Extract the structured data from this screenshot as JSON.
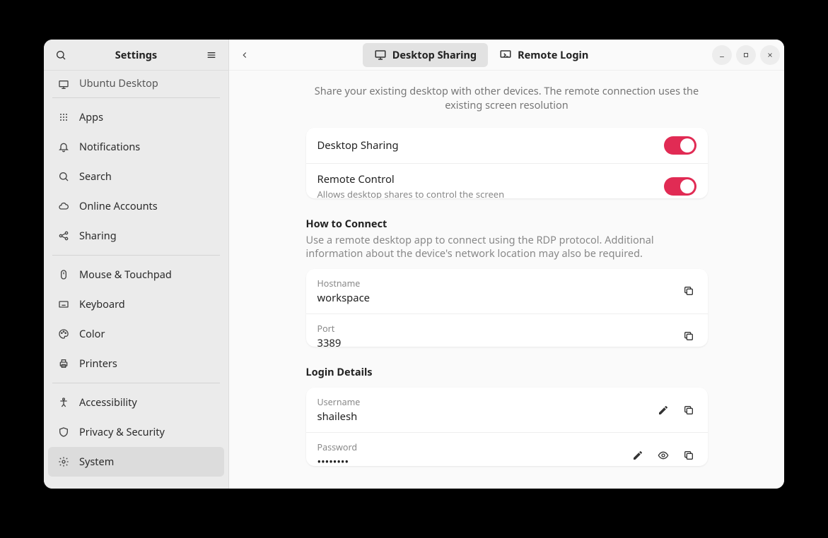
{
  "sidebar": {
    "title": "Settings",
    "partial_item_label": "Ubuntu Desktop",
    "groups": [
      [
        {
          "label": "Apps",
          "icon": "grid"
        },
        {
          "label": "Notifications",
          "icon": "bell"
        },
        {
          "label": "Search",
          "icon": "search"
        },
        {
          "label": "Online Accounts",
          "icon": "cloud"
        },
        {
          "label": "Sharing",
          "icon": "share"
        }
      ],
      [
        {
          "label": "Mouse & Touchpad",
          "icon": "mouse"
        },
        {
          "label": "Keyboard",
          "icon": "keyboard"
        },
        {
          "label": "Color",
          "icon": "palette"
        },
        {
          "label": "Printers",
          "icon": "printer"
        }
      ],
      [
        {
          "label": "Accessibility",
          "icon": "person"
        },
        {
          "label": "Privacy & Security",
          "icon": "shield"
        },
        {
          "label": "System",
          "icon": "gear",
          "active": true
        }
      ]
    ]
  },
  "header": {
    "tabs": [
      {
        "label": "Desktop Sharing",
        "active": true
      },
      {
        "label": "Remote Login",
        "active": false
      }
    ]
  },
  "intro": "Share your existing desktop with other devices. The remote connection uses the existing screen resolution",
  "toggles": {
    "desktop_sharing": {
      "title": "Desktop Sharing",
      "on": true
    },
    "remote_control": {
      "title": "Remote Control",
      "desc": "Allows desktop shares to control the screen",
      "on": true
    }
  },
  "how_to_connect": {
    "heading": "How to Connect",
    "desc": "Use a remote desktop app to connect using the RDP protocol. Additional information about the device's network location may also be required.",
    "hostname": {
      "label": "Hostname",
      "value": "workspace"
    },
    "port": {
      "label": "Port",
      "value": "3389"
    }
  },
  "login": {
    "heading": "Login Details",
    "username": {
      "label": "Username",
      "value": "shailesh"
    },
    "password": {
      "label": "Password",
      "value": "••••••••"
    }
  }
}
